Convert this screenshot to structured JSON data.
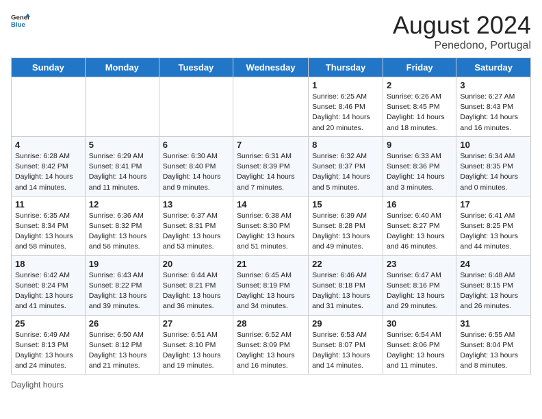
{
  "header": {
    "logo_general": "General",
    "logo_blue": "Blue",
    "month_year": "August 2024",
    "location": "Penedono, Portugal"
  },
  "footer": {
    "daylight_label": "Daylight hours"
  },
  "weekdays": [
    "Sunday",
    "Monday",
    "Tuesday",
    "Wednesday",
    "Thursday",
    "Friday",
    "Saturday"
  ],
  "weeks": [
    [
      {
        "day": "",
        "info": ""
      },
      {
        "day": "",
        "info": ""
      },
      {
        "day": "",
        "info": ""
      },
      {
        "day": "",
        "info": ""
      },
      {
        "day": "1",
        "info": "Sunrise: 6:25 AM\nSunset: 8:46 PM\nDaylight: 14 hours and 20 minutes."
      },
      {
        "day": "2",
        "info": "Sunrise: 6:26 AM\nSunset: 8:45 PM\nDaylight: 14 hours and 18 minutes."
      },
      {
        "day": "3",
        "info": "Sunrise: 6:27 AM\nSunset: 8:43 PM\nDaylight: 14 hours and 16 minutes."
      }
    ],
    [
      {
        "day": "4",
        "info": "Sunrise: 6:28 AM\nSunset: 8:42 PM\nDaylight: 14 hours and 14 minutes."
      },
      {
        "day": "5",
        "info": "Sunrise: 6:29 AM\nSunset: 8:41 PM\nDaylight: 14 hours and 11 minutes."
      },
      {
        "day": "6",
        "info": "Sunrise: 6:30 AM\nSunset: 8:40 PM\nDaylight: 14 hours and 9 minutes."
      },
      {
        "day": "7",
        "info": "Sunrise: 6:31 AM\nSunset: 8:39 PM\nDaylight: 14 hours and 7 minutes."
      },
      {
        "day": "8",
        "info": "Sunrise: 6:32 AM\nSunset: 8:37 PM\nDaylight: 14 hours and 5 minutes."
      },
      {
        "day": "9",
        "info": "Sunrise: 6:33 AM\nSunset: 8:36 PM\nDaylight: 14 hours and 3 minutes."
      },
      {
        "day": "10",
        "info": "Sunrise: 6:34 AM\nSunset: 8:35 PM\nDaylight: 14 hours and 0 minutes."
      }
    ],
    [
      {
        "day": "11",
        "info": "Sunrise: 6:35 AM\nSunset: 8:34 PM\nDaylight: 13 hours and 58 minutes."
      },
      {
        "day": "12",
        "info": "Sunrise: 6:36 AM\nSunset: 8:32 PM\nDaylight: 13 hours and 56 minutes."
      },
      {
        "day": "13",
        "info": "Sunrise: 6:37 AM\nSunset: 8:31 PM\nDaylight: 13 hours and 53 minutes."
      },
      {
        "day": "14",
        "info": "Sunrise: 6:38 AM\nSunset: 8:30 PM\nDaylight: 13 hours and 51 minutes."
      },
      {
        "day": "15",
        "info": "Sunrise: 6:39 AM\nSunset: 8:28 PM\nDaylight: 13 hours and 49 minutes."
      },
      {
        "day": "16",
        "info": "Sunrise: 6:40 AM\nSunset: 8:27 PM\nDaylight: 13 hours and 46 minutes."
      },
      {
        "day": "17",
        "info": "Sunrise: 6:41 AM\nSunset: 8:25 PM\nDaylight: 13 hours and 44 minutes."
      }
    ],
    [
      {
        "day": "18",
        "info": "Sunrise: 6:42 AM\nSunset: 8:24 PM\nDaylight: 13 hours and 41 minutes."
      },
      {
        "day": "19",
        "info": "Sunrise: 6:43 AM\nSunset: 8:22 PM\nDaylight: 13 hours and 39 minutes."
      },
      {
        "day": "20",
        "info": "Sunrise: 6:44 AM\nSunset: 8:21 PM\nDaylight: 13 hours and 36 minutes."
      },
      {
        "day": "21",
        "info": "Sunrise: 6:45 AM\nSunset: 8:19 PM\nDaylight: 13 hours and 34 minutes."
      },
      {
        "day": "22",
        "info": "Sunrise: 6:46 AM\nSunset: 8:18 PM\nDaylight: 13 hours and 31 minutes."
      },
      {
        "day": "23",
        "info": "Sunrise: 6:47 AM\nSunset: 8:16 PM\nDaylight: 13 hours and 29 minutes."
      },
      {
        "day": "24",
        "info": "Sunrise: 6:48 AM\nSunset: 8:15 PM\nDaylight: 13 hours and 26 minutes."
      }
    ],
    [
      {
        "day": "25",
        "info": "Sunrise: 6:49 AM\nSunset: 8:13 PM\nDaylight: 13 hours and 24 minutes."
      },
      {
        "day": "26",
        "info": "Sunrise: 6:50 AM\nSunset: 8:12 PM\nDaylight: 13 hours and 21 minutes."
      },
      {
        "day": "27",
        "info": "Sunrise: 6:51 AM\nSunset: 8:10 PM\nDaylight: 13 hours and 19 minutes."
      },
      {
        "day": "28",
        "info": "Sunrise: 6:52 AM\nSunset: 8:09 PM\nDaylight: 13 hours and 16 minutes."
      },
      {
        "day": "29",
        "info": "Sunrise: 6:53 AM\nSunset: 8:07 PM\nDaylight: 13 hours and 14 minutes."
      },
      {
        "day": "30",
        "info": "Sunrise: 6:54 AM\nSunset: 8:06 PM\nDaylight: 13 hours and 11 minutes."
      },
      {
        "day": "31",
        "info": "Sunrise: 6:55 AM\nSunset: 8:04 PM\nDaylight: 13 hours and 8 minutes."
      }
    ]
  ]
}
